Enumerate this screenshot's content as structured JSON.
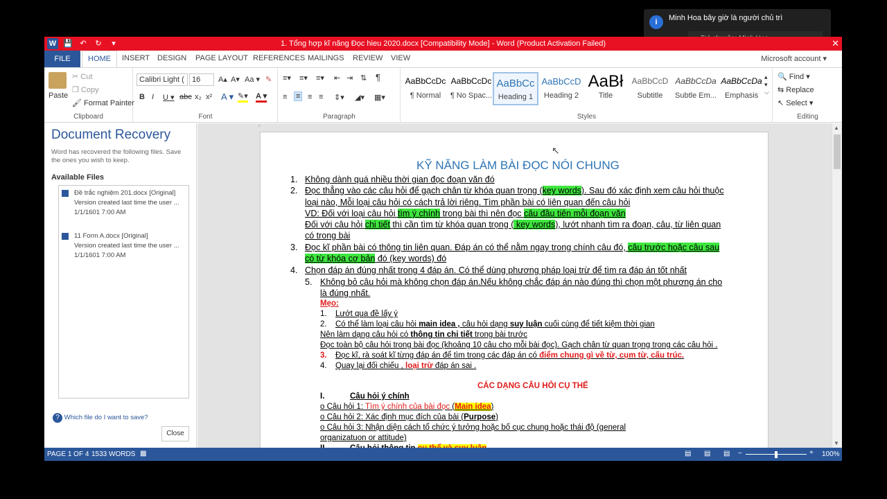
{
  "window": {
    "title": "1. Tổng hợp kĩ năng Đọc hieu 2020.docx [Compatibility Mode]  -  Word (Product Activation Failed)",
    "close": "✕"
  },
  "tabs": {
    "file": "FILE",
    "home": "HOME",
    "items": [
      "INSERT",
      "DESIGN",
      "PAGE LAYOUT",
      "REFERENCES",
      "MAILINGS",
      "REVIEW",
      "VIEW"
    ],
    "account": "Microsoft account ▾"
  },
  "notification": {
    "icon": "i",
    "text": "Minh Hoa bây giờ là người chủ trì",
    "sub": "Trò chuyện: Minh Hoa"
  },
  "clipboard": {
    "paste": "Paste",
    "cut": "Cut",
    "copy": "Copy",
    "format_painter": "Format Painter",
    "label": "Clipboard"
  },
  "font": {
    "name": "Calibri Light (",
    "size": "16",
    "grow": "A▴",
    "shrink": "A▾",
    "case": "Aa ▾",
    "label": "Font"
  },
  "paragraph": {
    "label": "Paragraph"
  },
  "styles": {
    "label": "Styles",
    "items": [
      {
        "preview": "AaBbCcDc",
        "name": "¶ Normal"
      },
      {
        "preview": "AaBbCcDc",
        "name": "¶ No Spac..."
      },
      {
        "preview": "AaBbCc",
        "name": "Heading 1"
      },
      {
        "preview": "AaBbCcD",
        "name": "Heading 2"
      },
      {
        "preview": "AaBł",
        "name": "Title"
      },
      {
        "preview": "AaBbCcD",
        "name": "Subtitle"
      },
      {
        "preview": "AaBbCcDa",
        "name": "Subtle Em..."
      },
      {
        "preview": "AaBbCcDa",
        "name": "Emphasis"
      }
    ]
  },
  "editing": {
    "find": "Find ▾",
    "replace": "Replace",
    "select": "Select ▾",
    "label": "Editing"
  },
  "recovery": {
    "title": "Document Recovery",
    "desc": "Word has recovered the following files.  Save the ones you wish to keep.",
    "available": "Available Files",
    "files": [
      {
        "name": "Đề trắc nghiệm 201.docx  [Original]",
        "note": "Version created last time the user ...",
        "date": "1/1/1601 7:00 AM"
      },
      {
        "name": "11 Form A.docx  [Original]",
        "note": "Version created last time the user ...",
        "date": "1/1/1601 7:00 AM"
      }
    ],
    "help": "Which file do I want to save?",
    "close": "Close"
  },
  "doc": {
    "heading": "KỸ NĂNG LÀM BÀI ĐỌC NÓI CHUNG",
    "n1": "1.",
    "l1": "Không dành quá nhiều thời gian đọc đoạn văn đó",
    "n2": "2.",
    "l2a": "Đọc thẳng vào các câu hỏi để gạch chân từ khóa quan trọng (",
    "l2kw": "key words",
    "l2b": "). Sau đó xác định xem câu hỏi thuộc",
    "l2c": "loại nào, Mỗi loại câu hỏi có cách trả lời riêng. Tìm phần  bài có liên quan đến câu hỏi",
    "vd_a": "VD: Đối với loại câu hỏi ",
    "vd_h1": "tìm ý chính",
    "vd_b": " trong bài thì nên đọc ",
    "vd_h2": "câu đầu tiên mỗi đoạn văn",
    "dv_a": "Đối với câu hỏi ",
    "dv_h1": "chi tiết",
    "dv_b": " thì cần tìm từ khóa quan trọng (",
    "dv_h2": " key words",
    "dv_c": "), lướt nhanh tìm ra đoạn, câu, từ liên quan",
    "dv_d": "có trong  bài",
    "n3": "3.",
    "l3a": "Đọc kĩ phần bài có thông tin liên quan. Đáp án có thể nằm ngay trong chính câu đó, ",
    "l3h": "câu trước hoặc câu sau",
    "l3h2": "có từ khóa cơ bản",
    "l3b": " đó (key words) đó",
    "n4": "4.",
    "l4": "Chọn đáp án đúng nhất trong 4 đáp án. Có thể dùng phương pháp loại trừ để tìm ra đáp án tốt nhất",
    "n5": "5.",
    "l5": "Không bỏ câu hỏi mà không chọn đáp án.Nếu không chắc đáp án nào đúng thì chọn một phương án cho",
    "l5b": "là đúng nhất.",
    "meo": "Mẹo:",
    "m1n": "1.",
    "m1": "Lướt qua đề lấy ý",
    "m2n": "2.",
    "m2a": "Có thể làm loại câu hỏi ",
    "m2b": "main idea ,",
    "m2c": " câu hỏi dạng ",
    "m2d": "suy luận",
    "m2e": " cuối cùng để tiết kiệm thời gian",
    "m2f": "Nên làm dạng câu hỏi có ",
    "m2g": "thông tin chi tiết",
    "m2h": " trong bài trước",
    "m2i": "Đọc toàn bộ câu hỏi trong bài đọc (khoảng 10 câu cho mỗi bài đọc). Gạch chân từ quan trọng trong các câu hỏi .",
    "m3n": "3.",
    "m3a": "Đọc kĩ, rà soát kĩ từng đáp án để tìm trong các đáp án có ",
    "m3b": "điểm chung gì về từ, cụm từ, cấu trúc.",
    "m4n": "4.",
    "m4a": "Quay lại đối chiếu , ",
    "m4b": "loại trừ",
    "m4c": " đáp án sai .",
    "sec": "CÁC DẠNG CÂU HỎI CỤ THỂ",
    "s1n": "I.",
    "s1": "Câu hỏi ý chính",
    "q1a": "o  Câu hỏi 1: ",
    "q1b": "Tìm ý chính của bài đọc",
    "q1c": " (",
    "q1d": "Main idea",
    "q1e": ")",
    "q2a": "o  Câu hỏi 2: Xác định mục đích của bài (",
    "q2b": "Purpose",
    "q2c": ")",
    "q3a": "o  Câu hỏi 3: Nhận diện cách tổ chức ý tưởng hoặc bố cục chung hoặc thái độ (general",
    "q3b": "organizatuon or attitude)",
    "s2n": "II.",
    "s2a": "Câu hỏi thông tin ",
    "s2b": "cụ thể và suy luận"
  },
  "status": {
    "page": "PAGE 1 OF 4",
    "words": "1533 WORDS",
    "zoom": "100%"
  }
}
